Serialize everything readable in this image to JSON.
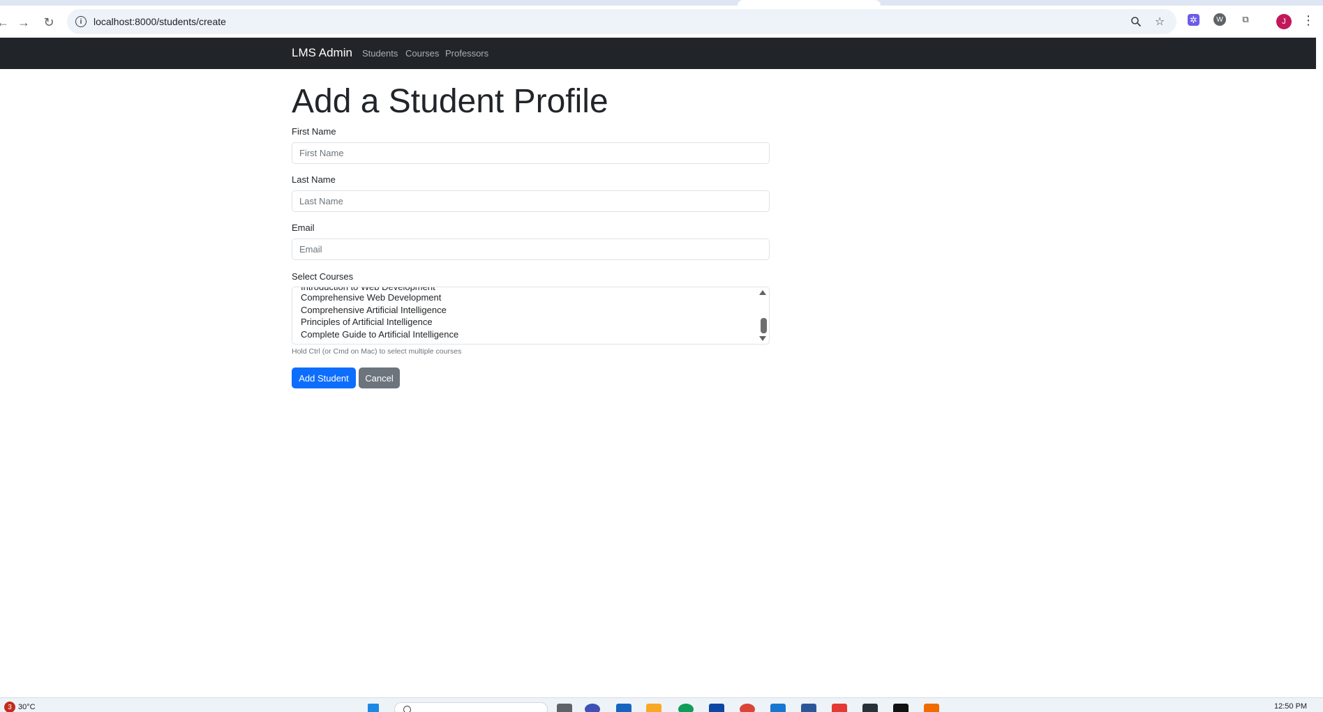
{
  "browser": {
    "url": "localhost:8000/students/create"
  },
  "navbar": {
    "brand": "LMS Admin",
    "links": [
      "Students",
      "Courses",
      "Professors"
    ]
  },
  "form": {
    "title": "Add a Student Profile",
    "first_name": {
      "label": "First Name",
      "placeholder": "First Name",
      "value": ""
    },
    "last_name": {
      "label": "Last Name",
      "placeholder": "Last Name",
      "value": ""
    },
    "email": {
      "label": "Email",
      "placeholder": "Email",
      "value": ""
    },
    "courses": {
      "label": "Select Courses",
      "options": [
        "Introduction to Web Development",
        "Comprehensive Web Development",
        "Comprehensive Artificial Intelligence",
        "Principles of Artificial Intelligence",
        "Complete Guide to Artificial Intelligence"
      ],
      "help": "Hold Ctrl (or Cmd on Mac) to select multiple courses"
    },
    "submit_label": "Add Student",
    "cancel_label": "Cancel"
  },
  "taskbar": {
    "weather_badge": "3",
    "temperature": "30°C",
    "time": "12:50 PM"
  },
  "colors": {
    "navbar_bg": "#212529",
    "primary": "#0d6efd",
    "secondary": "#6c757d"
  }
}
